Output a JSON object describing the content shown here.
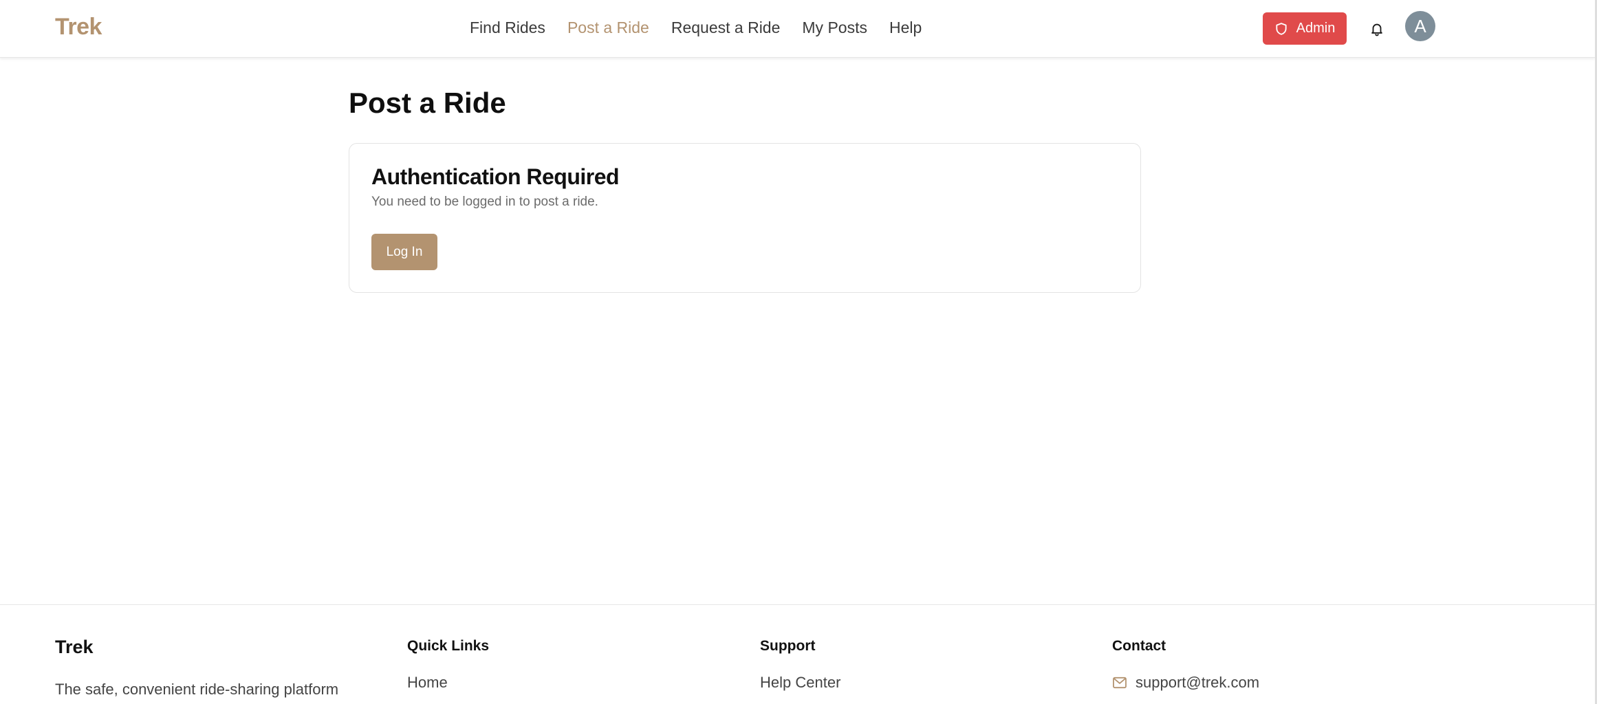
{
  "header": {
    "logo": "Trek",
    "nav": [
      {
        "label": "Find Rides",
        "active": false
      },
      {
        "label": "Post a Ride",
        "active": true
      },
      {
        "label": "Request a Ride",
        "active": false
      },
      {
        "label": "My Posts",
        "active": false
      },
      {
        "label": "Help",
        "active": false
      }
    ],
    "admin_label": "Admin",
    "avatar_initial": "A"
  },
  "main": {
    "page_title": "Post a Ride",
    "card": {
      "title": "Authentication Required",
      "description": "You need to be logged in to post a ride.",
      "login_label": "Log In"
    }
  },
  "footer": {
    "brand": "Trek",
    "tagline": "The safe, convenient ride-sharing platform",
    "quick_links": {
      "title": "Quick Links",
      "first_link": "Home"
    },
    "support": {
      "title": "Support",
      "first_link": "Help Center"
    },
    "contact": {
      "title": "Contact",
      "email": "support@trek.com"
    }
  },
  "icons": {
    "admin": "shield-icon",
    "notifications": "bell-icon",
    "email": "mail-icon"
  },
  "colors": {
    "brand": "#b39370",
    "admin": "#e04a4a",
    "avatar": "#7e8e99"
  }
}
